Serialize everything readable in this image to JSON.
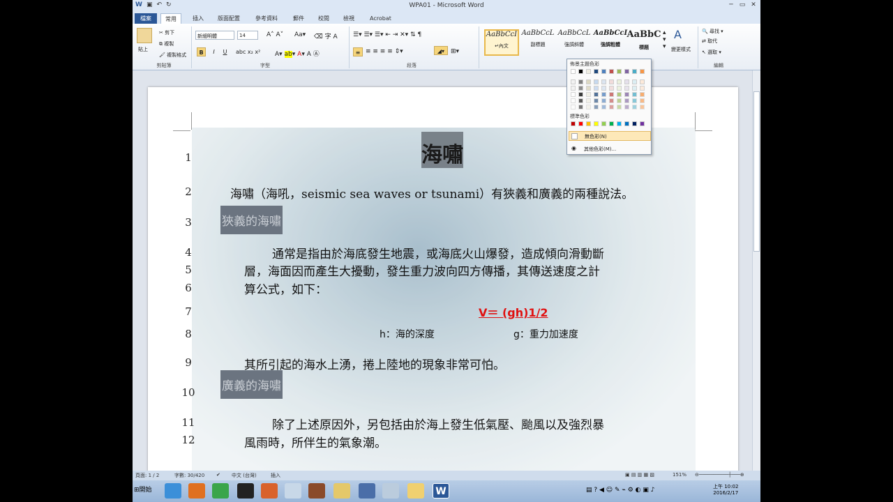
{
  "window": {
    "title": "WPA01 - Microsoft Word"
  },
  "tabs": [
    {
      "label": "檔案"
    },
    {
      "label": "常用"
    },
    {
      "label": "插入"
    },
    {
      "label": "版面配置"
    },
    {
      "label": "參考資料"
    },
    {
      "label": "郵件"
    },
    {
      "label": "校閱"
    },
    {
      "label": "檢視"
    },
    {
      "label": "Acrobat"
    }
  ],
  "ribbon": {
    "clipboard": {
      "paste": "貼上",
      "cut": "剪下",
      "copy": "複製",
      "format_painter": "複製格式",
      "label": "剪貼簿"
    },
    "font": {
      "name": "新細明體",
      "size": "14",
      "label": "字型"
    },
    "paragraph": {
      "label": "段落"
    },
    "styles": {
      "label": "樣式",
      "items": [
        {
          "preview": "AaBbCcI",
          "name": "↵內文"
        },
        {
          "preview": "AaBbCcL",
          "name": "副標題"
        },
        {
          "preview": "AaBbCcL",
          "name": "強調斜體"
        },
        {
          "preview": "AaBbCcI",
          "name": "強調粗體"
        },
        {
          "preview": "AaBbC",
          "name": "標題"
        }
      ],
      "change": "變更樣式"
    },
    "editing": {
      "find": "尋找",
      "replace": "取代",
      "select": "選取",
      "label": "編輯"
    }
  },
  "color_popup": {
    "theme_label": "佈景主題色彩",
    "standard_label": "標準色彩",
    "no_color": "無色彩(N)",
    "more_colors": "其他色彩(M)..."
  },
  "document": {
    "title": "海嘯",
    "line2": "海嘯（海吼，seismic sea waves or tsunami）有狹義和廣義的兩種說法。",
    "heading_narrow": "狹義的海嘯",
    "line4": "通常是指由於海底發生地震，或海底火山爆發，造成傾向滑動斷",
    "line5": "層，海面因而產生大擾動，發生重力波向四方傳播，其傳送速度之計",
    "line6": "算公式，如下：",
    "formula": "V＝ (gh)1/2",
    "h_def": "h：海的深度",
    "g_def": "g：重力加速度",
    "line9": "其所引起的海水上湧，捲上陸地的現象非常可怕。",
    "heading_broad": "廣義的海嘯",
    "line11": "除了上述原因外，另包括由於海上發生低氣壓、颱風以及強烈暴",
    "line12": "風雨時，所伴生的氣象潮。",
    "line_numbers": [
      "1",
      "2",
      "3",
      "4",
      "5",
      "6",
      "7",
      "8",
      "9",
      "10",
      "11",
      "12"
    ]
  },
  "status": {
    "page": "頁面: 1 / 2",
    "words": "字數: 30/420",
    "language": "中文 (台灣)",
    "mode": "插入",
    "zoom": "151%"
  },
  "taskbar": {
    "start": "開始",
    "clock_time": "上午 10:02",
    "clock_date": "2016/2/17"
  },
  "colors": {
    "accent": "#2b5797",
    "formula_red": "#e01010"
  }
}
